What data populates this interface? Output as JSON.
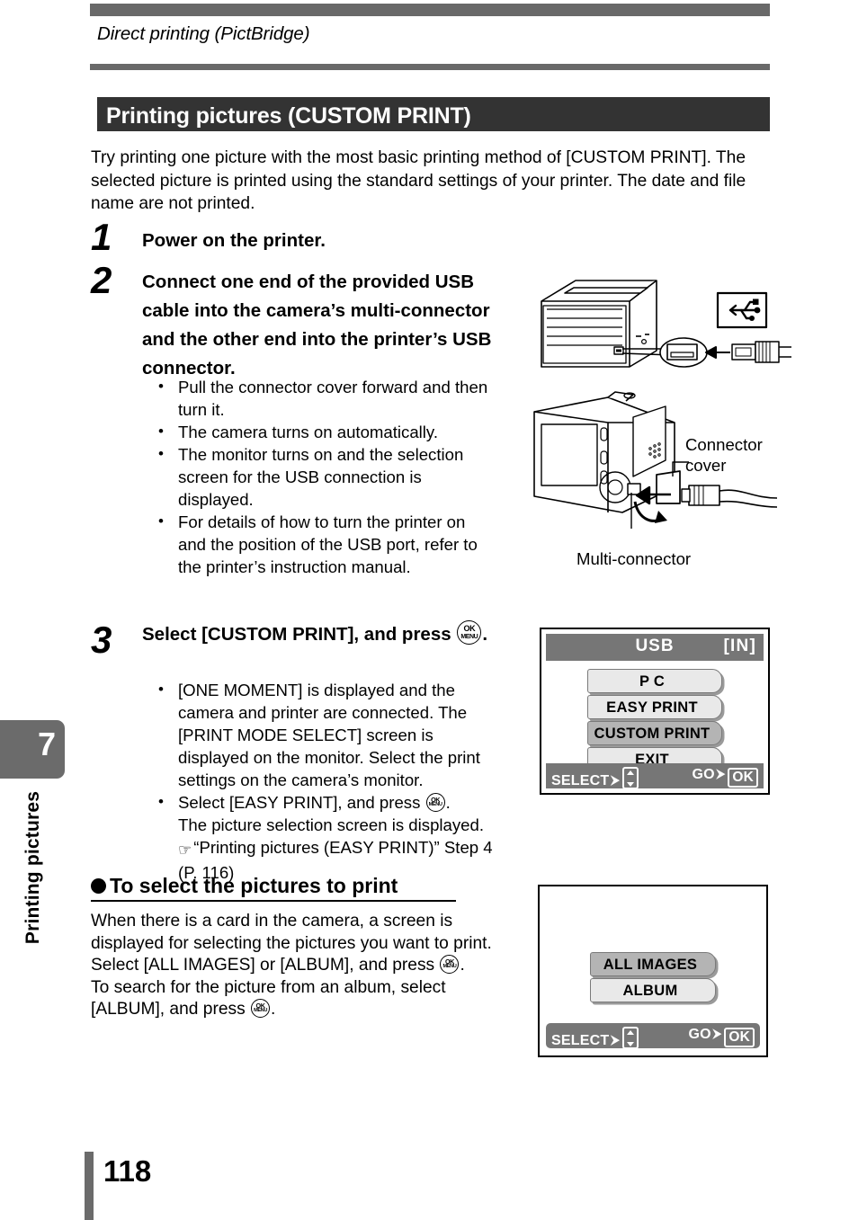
{
  "running_head": "Direct printing (PictBridge)",
  "section_title": "Printing pictures (CUSTOM PRINT)",
  "intro": "Try printing one picture with the most basic printing method of [CUSTOM PRINT]. The selected picture is printed using the standard settings of your printer. The date and file name are not printed.",
  "steps": [
    {
      "number": "1",
      "heading": "Power on the printer.",
      "bullets": []
    },
    {
      "number": "2",
      "heading": "Connect one end of the provided USB cable into the camera’s multi-connector and the other end into the printer’s USB connector.",
      "bullets": [
        "Pull the connector cover forward and then turn it.",
        "The camera turns on automatically.",
        "The monitor turns on and the selection screen for the USB connection is displayed.",
        "For details of how to turn the printer on and the position of the USB port, refer to the printer’s instruction manual."
      ]
    },
    {
      "number": "3",
      "heading_part1": "Select [CUSTOM PRINT], and press ",
      "heading_part2": ".",
      "bullets": [
        "[ONE MOMENT] is displayed and the camera and printer are connected. The [PRINT MODE SELECT] screen is displayed on the monitor. Select the print settings on the camera’s monitor.",
        "Select [EASY PRINT], and press "
      ],
      "bullet2_tail": ".",
      "bullet2_line2": "The picture selection screen is displayed.",
      "reference": "“Printing pictures (EASY PRINT)” Step 4 (P. 116)"
    }
  ],
  "illustration": {
    "connector_cover_label": "Connector\ncover",
    "connector_cover_line1": "Connector",
    "connector_cover_line2": "cover",
    "multi_connector_label": "Multi-connector"
  },
  "subsection": {
    "heading": "To select the pictures to print",
    "body_line1": "When there is a card in the camera, a screen is displayed for selecting the pictures you want to print.",
    "body_line2_pre": "Select [ALL IMAGES] or [ALBUM], and press ",
    "body_line2_post": ".",
    "body_line3_pre": "To search for the picture from an album, select [ALBUM], and press ",
    "body_line3_post": "."
  },
  "lcd_usb": {
    "title": "USB",
    "badge": "[IN]",
    "items": [
      {
        "label": "P  C",
        "selected": false
      },
      {
        "label": "EASY PRINT",
        "selected": false
      },
      {
        "label": "CUSTOM PRINT",
        "selected": true
      },
      {
        "label": "EXIT",
        "selected": false
      }
    ],
    "footer_left": "SELECT",
    "footer_right": "GO",
    "footer_ok": "OK"
  },
  "lcd_images": {
    "items": [
      {
        "label": "ALL IMAGES",
        "selected": true
      },
      {
        "label": "ALBUM",
        "selected": false
      }
    ],
    "footer_left": "SELECT",
    "footer_right": "GO",
    "footer_ok": "OK"
  },
  "chapter": {
    "number": "7",
    "label": "Printing pictures"
  },
  "page_number": "118",
  "icons": {
    "ok_menu_top": "OK",
    "ok_menu_bottom": "MENU",
    "hand_pointer": "☞",
    "arrow_right": "⮞"
  },
  "colors": {
    "gray_bar": "#696969",
    "section_bar": "#333333",
    "lcd_gray": "#767676",
    "menu_item": "#e9e9e9",
    "menu_item_selected": "#b4b4b4"
  }
}
